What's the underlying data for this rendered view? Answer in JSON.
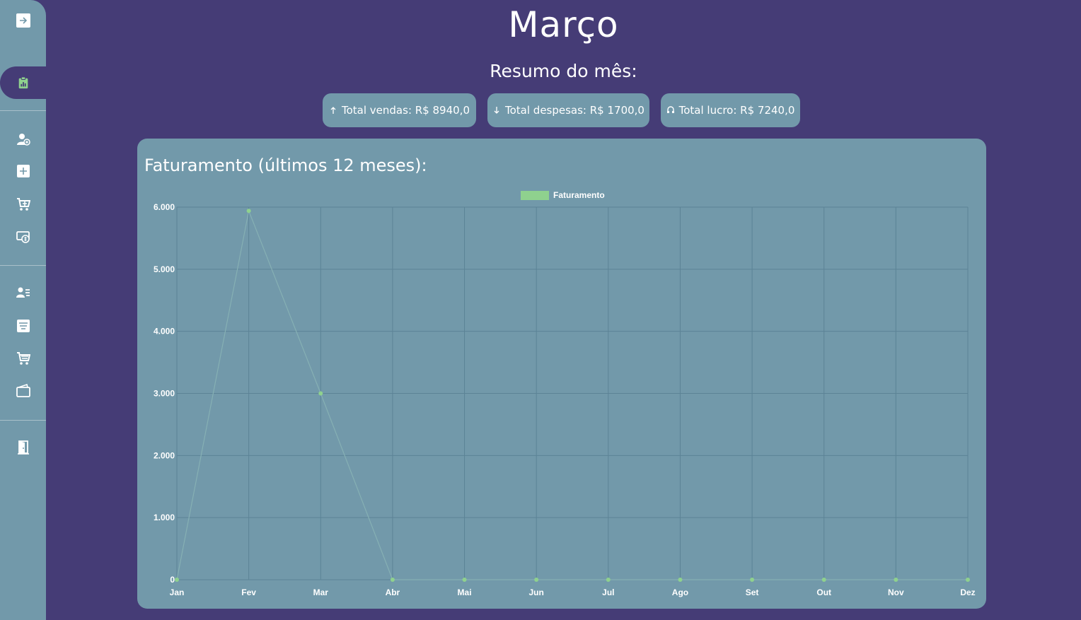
{
  "page": {
    "title": "Março",
    "subtitle": "Resumo do mês:"
  },
  "summary": {
    "sales": "Total vendas: R$ 8940,0",
    "expenses": "Total despesas: R$ 1700,0",
    "profit": "Total lucro: R$ 7240,0"
  },
  "sidebar": {
    "icons": [
      "expand-icon",
      "dashboard-icon",
      "add-user-icon",
      "add-product-icon",
      "add-to-cart-icon",
      "expense-icon",
      "clients-list-icon",
      "products-list-icon",
      "sales-list-icon",
      "wallet-icon",
      "exit-door-icon"
    ]
  },
  "card": {
    "title": "Faturamento (últimos 12 meses):"
  },
  "colors": {
    "background": "#453c76",
    "panel": "#7299aa",
    "series": "#8fd18e"
  },
  "chart_data": {
    "type": "line",
    "title": "",
    "xlabel": "",
    "ylabel": "",
    "categories": [
      "Jan",
      "Fev",
      "Mar",
      "Abr",
      "Mai",
      "Jun",
      "Jul",
      "Ago",
      "Set",
      "Out",
      "Nov",
      "Dez"
    ],
    "series": [
      {
        "name": "Faturamento",
        "values": [
          0,
          5940,
          3000,
          0,
          0,
          0,
          0,
          0,
          0,
          0,
          0,
          0
        ]
      }
    ],
    "ylim": [
      0,
      6000
    ],
    "yticks": [
      "0",
      "1.000",
      "2.000",
      "3.000",
      "4.000",
      "5.000",
      "6.000"
    ],
    "grid": true,
    "legend": "top-center"
  }
}
